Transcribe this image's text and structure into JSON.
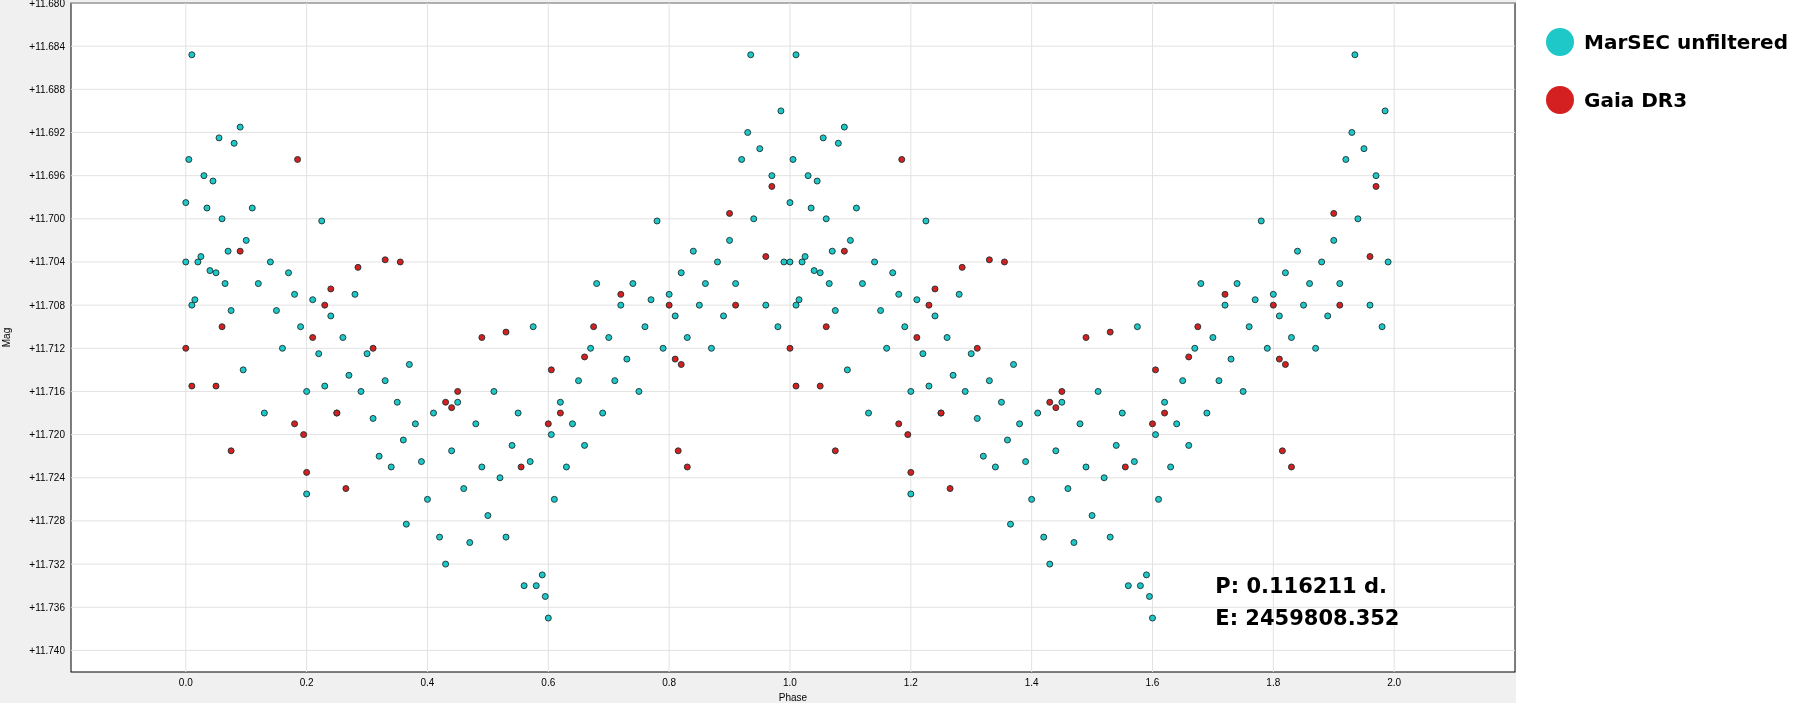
{
  "chart_data": {
    "type": "scatter",
    "xlabel": "Phase",
    "ylabel": "Mag",
    "xlim": [
      -0.19,
      2.2
    ],
    "ylim": [
      11.742,
      11.68
    ],
    "grid": true,
    "xticks": [
      {
        "value": 0,
        "label": "0.0"
      },
      {
        "value": 0.2,
        "label": "0.2"
      },
      {
        "value": 0.4,
        "label": "0.4"
      },
      {
        "value": 0.6,
        "label": "0.6"
      },
      {
        "value": 0.8,
        "label": "0.8"
      },
      {
        "value": 1,
        "label": "1.0"
      },
      {
        "value": 1.2,
        "label": "1.2"
      },
      {
        "value": 1.4,
        "label": "1.4"
      },
      {
        "value": 1.6,
        "label": "1.6"
      },
      {
        "value": 1.8,
        "label": "1.8"
      },
      {
        "value": 2,
        "label": "2.0"
      }
    ],
    "yticks": [
      {
        "value": 11.68,
        "label": "+11.680"
      },
      {
        "value": 11.684,
        "label": "+11.684"
      },
      {
        "value": 11.688,
        "label": "+11.688"
      },
      {
        "value": 11.692,
        "label": "+11.692"
      },
      {
        "value": 11.696,
        "label": "+11.696"
      },
      {
        "value": 11.7,
        "label": "+11.700"
      },
      {
        "value": 11.704,
        "label": "+11.704"
      },
      {
        "value": 11.708,
        "label": "+11.708"
      },
      {
        "value": 11.712,
        "label": "+11.712"
      },
      {
        "value": 11.716,
        "label": "+11.716"
      },
      {
        "value": 11.72,
        "label": "+11.720"
      },
      {
        "value": 11.724,
        "label": "+11.724"
      },
      {
        "value": 11.728,
        "label": "+11.728"
      },
      {
        "value": 11.732,
        "label": "+11.732"
      },
      {
        "value": 11.736,
        "label": "+11.736"
      },
      {
        "value": 11.74,
        "label": "+11.740"
      }
    ],
    "series": [
      {
        "name": "MarSEC unfiltered",
        "color": "#1ec8c8",
        "x": [
          0,
          0,
          0.005,
          0.01,
          0.01,
          0.015,
          0.02,
          0.025,
          0.03,
          0.035,
          0.04,
          0.045,
          0.05,
          0.055,
          0.06,
          0.065,
          0.07,
          0.075,
          0.08,
          0.09,
          0.095,
          0.1,
          0.11,
          0.12,
          0.13,
          0.14,
          0.15,
          0.16,
          0.17,
          0.18,
          0.19,
          0.2,
          0.2,
          0.21,
          0.22,
          0.225,
          0.23,
          0.24,
          0.25,
          0.26,
          0.27,
          0.28,
          0.29,
          0.3,
          0.31,
          0.32,
          0.33,
          0.34,
          0.35,
          0.36,
          0.365,
          0.37,
          0.38,
          0.39,
          0.4,
          0.41,
          0.42,
          0.43,
          0.44,
          0.45,
          0.46,
          0.47,
          0.48,
          0.49,
          0.5,
          0.51,
          0.52,
          0.53,
          0.54,
          0.55,
          0.56,
          0.57,
          0.575,
          0.58,
          0.59,
          0.595,
          0.6,
          0.605,
          0.61,
          0.62,
          0.63,
          0.64,
          0.65,
          0.66,
          0.67,
          0.68,
          0.69,
          0.7,
          0.71,
          0.72,
          0.73,
          0.74,
          0.75,
          0.76,
          0.77,
          0.78,
          0.79,
          0.8,
          0.81,
          0.82,
          0.83,
          0.84,
          0.85,
          0.86,
          0.87,
          0.88,
          0.89,
          0.9,
          0.91,
          0.92,
          0.93,
          0.935,
          0.94,
          0.95,
          0.96,
          0.97,
          0.98,
          0.985,
          0.99,
          1,
          1,
          1.005,
          1.01,
          1.01,
          1.015,
          1.02,
          1.025,
          1.03,
          1.035,
          1.04,
          1.045,
          1.05,
          1.055,
          1.06,
          1.065,
          1.07,
          1.075,
          1.08,
          1.09,
          1.095,
          1.1,
          1.11,
          1.12,
          1.13,
          1.14,
          1.15,
          1.16,
          1.17,
          1.18,
          1.19,
          1.2,
          1.2,
          1.21,
          1.22,
          1.225,
          1.23,
          1.24,
          1.25,
          1.26,
          1.27,
          1.28,
          1.29,
          1.3,
          1.31,
          1.32,
          1.33,
          1.34,
          1.35,
          1.36,
          1.365,
          1.37,
          1.38,
          1.39,
          1.4,
          1.41,
          1.42,
          1.43,
          1.44,
          1.45,
          1.46,
          1.47,
          1.48,
          1.49,
          1.5,
          1.51,
          1.52,
          1.53,
          1.54,
          1.55,
          1.56,
          1.57,
          1.575,
          1.58,
          1.59,
          1.595,
          1.6,
          1.605,
          1.61,
          1.62,
          1.63,
          1.64,
          1.65,
          1.66,
          1.67,
          1.68,
          1.69,
          1.7,
          1.71,
          1.72,
          1.73,
          1.74,
          1.75,
          1.76,
          1.77,
          1.78,
          1.79,
          1.8,
          1.81,
          1.82,
          1.83,
          1.84,
          1.85,
          1.86,
          1.87,
          1.88,
          1.89,
          1.9,
          1.91,
          1.92,
          1.93,
          1.935,
          1.94,
          1.95,
          1.96,
          1.97,
          1.98,
          1.985,
          1.99
        ],
        "values": [
          11.6985,
          11.704,
          11.6945,
          11.6848,
          11.708,
          11.7075,
          11.704,
          11.7035,
          11.696,
          11.699,
          11.7048,
          11.6965,
          11.705,
          11.6925,
          11.7,
          11.706,
          11.703,
          11.7085,
          11.693,
          11.6915,
          11.714,
          11.702,
          11.699,
          11.706,
          11.718,
          11.704,
          11.7085,
          11.712,
          11.705,
          11.707,
          11.71,
          11.716,
          11.7255,
          11.7075,
          11.7125,
          11.7002,
          11.7155,
          11.709,
          11.718,
          11.711,
          11.7145,
          11.707,
          11.716,
          11.7125,
          11.7185,
          11.722,
          11.715,
          11.723,
          11.717,
          11.7205,
          11.7283,
          11.7135,
          11.719,
          11.7225,
          11.726,
          11.718,
          11.7295,
          11.732,
          11.7215,
          11.717,
          11.725,
          11.73,
          11.719,
          11.723,
          11.7275,
          11.716,
          11.724,
          11.7295,
          11.721,
          11.718,
          11.734,
          11.7225,
          11.71,
          11.734,
          11.733,
          11.735,
          11.737,
          11.72,
          11.726,
          11.717,
          11.723,
          11.719,
          11.715,
          11.721,
          11.712,
          11.706,
          11.718,
          11.711,
          11.715,
          11.708,
          11.713,
          11.706,
          11.716,
          11.71,
          11.7075,
          11.7002,
          11.712,
          11.707,
          11.709,
          11.705,
          11.711,
          11.703,
          11.708,
          11.706,
          11.712,
          11.704,
          11.709,
          11.702,
          11.706,
          11.6945,
          11.692,
          11.6848,
          11.7,
          11.6935,
          11.708,
          11.696,
          11.71,
          11.69,
          11.704,
          11.6985,
          11.704,
          11.6945,
          11.6848,
          11.708,
          11.7075,
          11.704,
          11.7035,
          11.696,
          11.699,
          11.7048,
          11.6965,
          11.705,
          11.6925,
          11.7,
          11.706,
          11.703,
          11.7085,
          11.693,
          11.6915,
          11.714,
          11.702,
          11.699,
          11.706,
          11.718,
          11.704,
          11.7085,
          11.712,
          11.705,
          11.707,
          11.71,
          11.716,
          11.7255,
          11.7075,
          11.7125,
          11.7002,
          11.7155,
          11.709,
          11.718,
          11.711,
          11.7145,
          11.707,
          11.716,
          11.7125,
          11.7185,
          11.722,
          11.715,
          11.723,
          11.717,
          11.7205,
          11.7283,
          11.7135,
          11.719,
          11.7225,
          11.726,
          11.718,
          11.7295,
          11.732,
          11.7215,
          11.717,
          11.725,
          11.73,
          11.719,
          11.723,
          11.7275,
          11.716,
          11.724,
          11.7295,
          11.721,
          11.718,
          11.734,
          11.7225,
          11.71,
          11.734,
          11.733,
          11.735,
          11.737,
          11.72,
          11.726,
          11.717,
          11.723,
          11.719,
          11.715,
          11.721,
          11.712,
          11.706,
          11.718,
          11.711,
          11.715,
          11.708,
          11.713,
          11.706,
          11.716,
          11.71,
          11.7075,
          11.7002,
          11.712,
          11.707,
          11.709,
          11.705,
          11.711,
          11.703,
          11.708,
          11.706,
          11.712,
          11.704,
          11.709,
          11.702,
          11.706,
          11.6945,
          11.692,
          11.6848,
          11.7,
          11.6935,
          11.708,
          11.696,
          11.71,
          11.69,
          11.704
        ]
      },
      {
        "name": "Gaia DR3",
        "color": "#d42020",
        "x": [
          0,
          0.01,
          0.05,
          0.06,
          0.075,
          0.09,
          0.18,
          0.185,
          0.195,
          0.2,
          0.21,
          0.23,
          0.24,
          0.25,
          0.265,
          0.285,
          0.31,
          0.33,
          0.355,
          0.43,
          0.44,
          0.45,
          0.49,
          0.53,
          0.555,
          0.6,
          0.605,
          0.62,
          0.66,
          0.675,
          0.72,
          0.8,
          0.81,
          0.815,
          0.82,
          0.83,
          0.9,
          0.91,
          0.96,
          0.97,
          1,
          1.01,
          1.05,
          1.06,
          1.075,
          1.09,
          1.18,
          1.185,
          1.195,
          1.2,
          1.21,
          1.23,
          1.24,
          1.25,
          1.265,
          1.285,
          1.31,
          1.33,
          1.355,
          1.43,
          1.44,
          1.45,
          1.49,
          1.53,
          1.555,
          1.6,
          1.605,
          1.62,
          1.66,
          1.675,
          1.72,
          1.8,
          1.81,
          1.815,
          1.82,
          1.83,
          1.9,
          1.91,
          1.96,
          1.97
        ],
        "values": [
          11.712,
          11.7155,
          11.7155,
          11.71,
          11.7215,
          11.703,
          11.719,
          11.6945,
          11.72,
          11.7235,
          11.711,
          11.708,
          11.7065,
          11.718,
          11.725,
          11.7045,
          11.712,
          11.7038,
          11.704,
          11.717,
          11.7175,
          11.716,
          11.711,
          11.7105,
          11.723,
          11.719,
          11.714,
          11.718,
          11.7128,
          11.71,
          11.707,
          11.708,
          11.713,
          11.7215,
          11.7135,
          11.723,
          11.6995,
          11.708,
          11.7035,
          11.697,
          11.712,
          11.7155,
          11.7155,
          11.71,
          11.7215,
          11.703,
          11.719,
          11.6945,
          11.72,
          11.7235,
          11.711,
          11.708,
          11.7065,
          11.718,
          11.725,
          11.7045,
          11.712,
          11.7038,
          11.704,
          11.717,
          11.7175,
          11.716,
          11.711,
          11.7105,
          11.723,
          11.719,
          11.714,
          11.718,
          11.7128,
          11.71,
          11.707,
          11.708,
          11.713,
          11.7215,
          11.7135,
          11.723,
          11.6995,
          11.708,
          11.7035,
          11.697
        ]
      }
    ],
    "annotations": [
      "P: 0.116211 d.",
      "E: 2459808.352"
    ]
  }
}
